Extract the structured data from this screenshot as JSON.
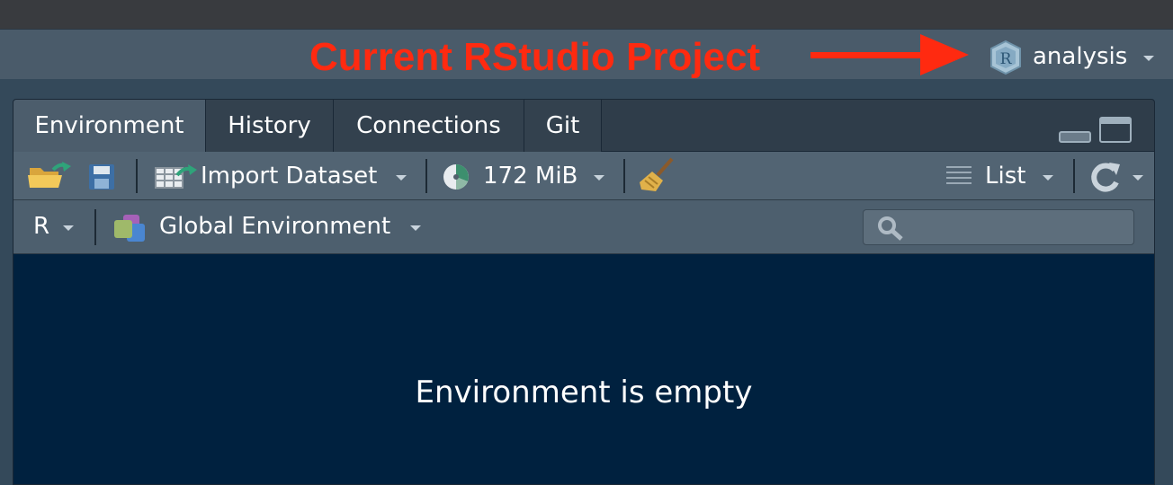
{
  "annotation": {
    "text": "Current RStudio Project",
    "color": "#ff2a10"
  },
  "project": {
    "name": "analysis",
    "icon": "rstudio-project-icon"
  },
  "tabs": [
    {
      "label": "Environment",
      "active": true
    },
    {
      "label": "History",
      "active": false
    },
    {
      "label": "Connections",
      "active": false
    },
    {
      "label": "Git",
      "active": false
    }
  ],
  "toolbar": {
    "open_icon": "folder-open-icon",
    "save_icon": "save-icon",
    "import_label": "Import Dataset",
    "memory_label": "172 MiB",
    "clear_icon": "broom-icon",
    "view_label": "List",
    "refresh_icon": "refresh-icon"
  },
  "envbar": {
    "language": "R",
    "scope": "Global Environment",
    "search_placeholder": ""
  },
  "main": {
    "empty_message": "Environment is empty"
  },
  "colors": {
    "pane_bg": "#00213f",
    "toolbar_bg": "#526473",
    "annotation": "#ff2a10"
  }
}
